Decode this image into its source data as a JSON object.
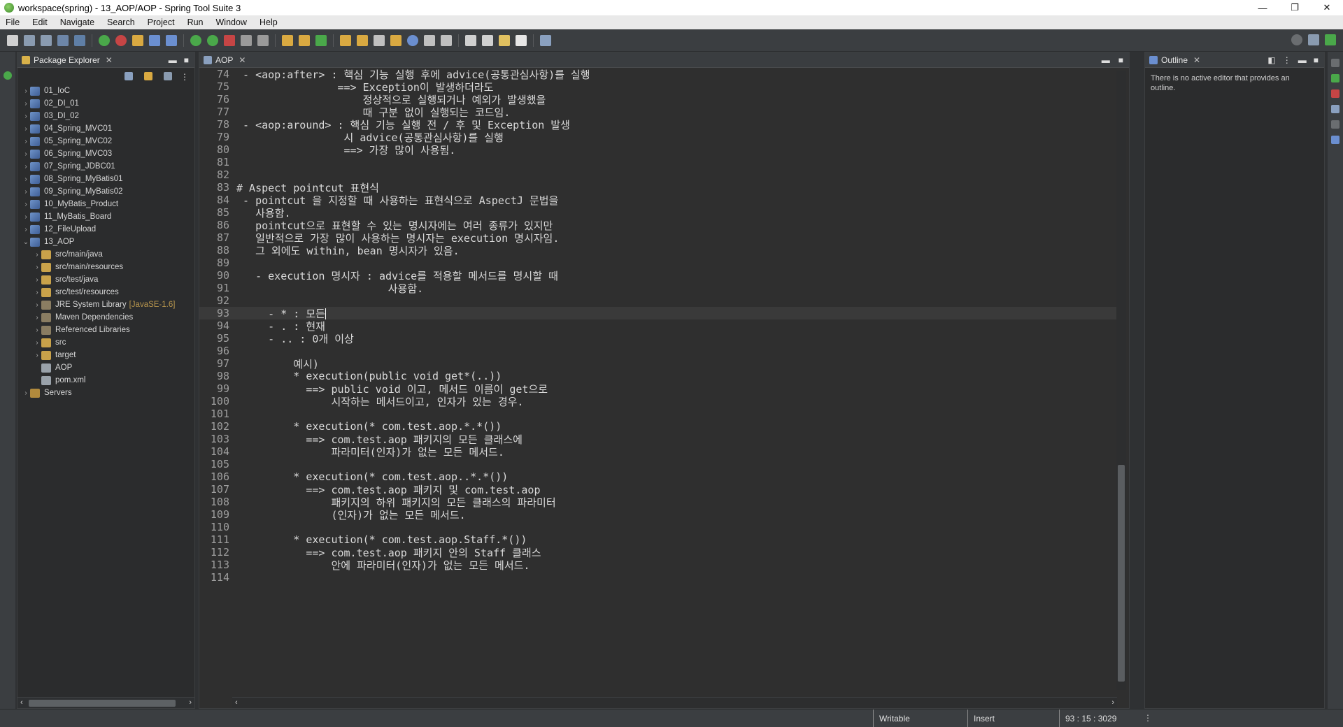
{
  "window": {
    "title": "workspace(spring) - 13_AOP/AOP - Spring Tool Suite 3",
    "minimize_glyph": "—",
    "restore_glyph": "❐",
    "close_glyph": "✕"
  },
  "menu": [
    "File",
    "Edit",
    "Navigate",
    "Search",
    "Project",
    "Run",
    "Window",
    "Help"
  ],
  "package_explorer": {
    "title": "Package Explorer",
    "close_glyph": "✕",
    "items": [
      {
        "label": "01_IoC",
        "depth": 0,
        "chevron": "›",
        "icon": "project"
      },
      {
        "label": "02_DI_01",
        "depth": 0,
        "chevron": "›",
        "icon": "project"
      },
      {
        "label": "03_DI_02",
        "depth": 0,
        "chevron": "›",
        "icon": "project"
      },
      {
        "label": "04_Spring_MVC01",
        "depth": 0,
        "chevron": "›",
        "icon": "project"
      },
      {
        "label": "05_Spring_MVC02",
        "depth": 0,
        "chevron": "›",
        "icon": "project"
      },
      {
        "label": "06_Spring_MVC03",
        "depth": 0,
        "chevron": "›",
        "icon": "project"
      },
      {
        "label": "07_Spring_JDBC01",
        "depth": 0,
        "chevron": "›",
        "icon": "project"
      },
      {
        "label": "08_Spring_MyBatis01",
        "depth": 0,
        "chevron": "›",
        "icon": "project"
      },
      {
        "label": "09_Spring_MyBatis02",
        "depth": 0,
        "chevron": "›",
        "icon": "project"
      },
      {
        "label": "10_MyBatis_Product",
        "depth": 0,
        "chevron": "›",
        "icon": "project"
      },
      {
        "label": "11_MyBatis_Board",
        "depth": 0,
        "chevron": "›",
        "icon": "project"
      },
      {
        "label": "12_FileUpload",
        "depth": 0,
        "chevron": "›",
        "icon": "project"
      },
      {
        "label": "13_AOP",
        "depth": 0,
        "chevron": "⌄",
        "icon": "project"
      },
      {
        "label": "src/main/java",
        "depth": 1,
        "chevron": "›",
        "icon": "source-folder"
      },
      {
        "label": "src/main/resources",
        "depth": 1,
        "chevron": "›",
        "icon": "source-folder"
      },
      {
        "label": "src/test/java",
        "depth": 1,
        "chevron": "›",
        "icon": "source-folder"
      },
      {
        "label": "src/test/resources",
        "depth": 1,
        "chevron": "›",
        "icon": "source-folder"
      },
      {
        "label": "JRE System Library",
        "suffix": "[JavaSE-1.6]",
        "depth": 1,
        "chevron": "›",
        "icon": "library"
      },
      {
        "label": "Maven Dependencies",
        "depth": 1,
        "chevron": "›",
        "icon": "library"
      },
      {
        "label": "Referenced Libraries",
        "depth": 1,
        "chevron": "›",
        "icon": "library"
      },
      {
        "label": "src",
        "depth": 1,
        "chevron": "›",
        "icon": "folder"
      },
      {
        "label": "target",
        "depth": 1,
        "chevron": "›",
        "icon": "folder"
      },
      {
        "label": "AOP",
        "depth": 1,
        "chevron": "",
        "icon": "file"
      },
      {
        "label": "pom.xml",
        "depth": 1,
        "chevron": "",
        "icon": "file"
      },
      {
        "label": "Servers",
        "depth": 0,
        "chevron": "›",
        "icon": "servers-folder"
      }
    ]
  },
  "editor": {
    "tab_label": "AOP",
    "close_glyph": "✕",
    "current_line": 93,
    "lines": [
      {
        "n": "74",
        "text": " - <aop:after> : 핵심 기능 실행 후에 advice(공통관심사항)를 실행"
      },
      {
        "n": "75",
        "text": "                ==> Exception이 발생하더라도"
      },
      {
        "n": "76",
        "text": "                    정상적으로 실행되거나 예외가 발생했을"
      },
      {
        "n": "77",
        "text": "                    때 구분 없이 실행되는 코드임."
      },
      {
        "n": "78",
        "text": " - <aop:around> : 핵심 기능 실행 전 / 후 및 Exception 발생"
      },
      {
        "n": "79",
        "text": "                 시 advice(공통관심사항)를 실행"
      },
      {
        "n": "80",
        "text": "                 ==> 가장 많이 사용됨."
      },
      {
        "n": "81",
        "text": ""
      },
      {
        "n": "82",
        "text": ""
      },
      {
        "n": "83",
        "text": "# Aspect pointcut 표현식"
      },
      {
        "n": "84",
        "text": " - pointcut 을 지정할 때 사용하는 표현식으로 AspectJ 문법을"
      },
      {
        "n": "85",
        "text": "   사용함."
      },
      {
        "n": "86",
        "text": "   pointcut으로 표현할 수 있는 명시자에는 여러 종류가 있지만"
      },
      {
        "n": "87",
        "text": "   일반적으로 가장 많이 사용하는 명시자는 execution 명시자임."
      },
      {
        "n": "88",
        "text": "   그 외에도 within, bean 명시자가 있음."
      },
      {
        "n": "89",
        "text": ""
      },
      {
        "n": "90",
        "text": "   - execution 명시자 : advice를 적용할 메서드를 명시할 때"
      },
      {
        "n": "91",
        "text": "                        사용함."
      },
      {
        "n": "92",
        "text": ""
      },
      {
        "n": "93",
        "text": "     - * : 모든"
      },
      {
        "n": "94",
        "text": "     - . : 현재"
      },
      {
        "n": "95",
        "text": "     - .. : 0개 이상"
      },
      {
        "n": "96",
        "text": ""
      },
      {
        "n": "97",
        "text": "         예시)"
      },
      {
        "n": "98",
        "text": "         * execution(public void get*(..))"
      },
      {
        "n": "99",
        "text": "           ==> public void 이고, 메서드 이름이 get으로"
      },
      {
        "n": "100",
        "text": "               시작하는 메서드이고, 인자가 있는 경우."
      },
      {
        "n": "101",
        "text": ""
      },
      {
        "n": "102",
        "text": "         * execution(* com.test.aop.*.*())"
      },
      {
        "n": "103",
        "text": "           ==> com.test.aop 패키지의 모든 클래스에"
      },
      {
        "n": "104",
        "text": "               파라미터(인자)가 없는 모든 메서드."
      },
      {
        "n": "105",
        "text": ""
      },
      {
        "n": "106",
        "text": "         * execution(* com.test.aop..*.*())"
      },
      {
        "n": "107",
        "text": "           ==> com.test.aop 패키지 및 com.test.aop"
      },
      {
        "n": "108",
        "text": "               패키지의 하위 패키지의 모든 클래스의 파라미터"
      },
      {
        "n": "109",
        "text": "               (인자)가 없는 모든 메서드."
      },
      {
        "n": "110",
        "text": ""
      },
      {
        "n": "111",
        "text": "         * execution(* com.test.aop.Staff.*())"
      },
      {
        "n": "112",
        "text": "           ==> com.test.aop 패키지 안의 Staff 클래스"
      },
      {
        "n": "113",
        "text": "               안에 파라미터(인자)가 없는 모든 메서드."
      },
      {
        "n": "114",
        "text": ""
      }
    ]
  },
  "outline": {
    "title": "Outline",
    "close_glyph": "✕",
    "message": "There is no active editor that provides an outline."
  },
  "statusbar": {
    "writable": "Writable",
    "insert_mode": "Insert",
    "position": "93 : 15 : 3029"
  },
  "colors": {
    "accent_green": "#4aa84a",
    "editor_bg": "#2f2f2f",
    "squiggle": "#d24040"
  }
}
